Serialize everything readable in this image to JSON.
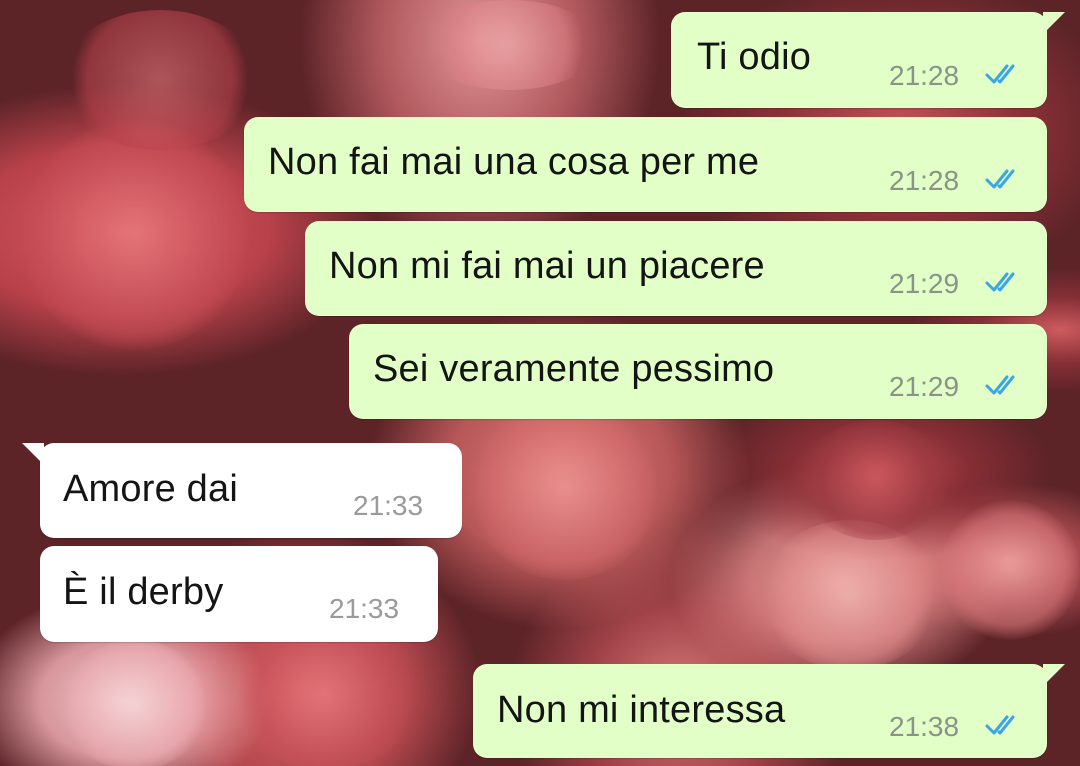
{
  "colors": {
    "outgoing_bubble": "#e2ffc8",
    "incoming_bubble": "#ffffff",
    "read_ticks": "#3aa6e8"
  },
  "messages": [
    {
      "direction": "outgoing",
      "text": "Ti odio",
      "time": "21:28",
      "status": "read",
      "status_icon": "double-check-icon"
    },
    {
      "direction": "outgoing",
      "text": "Non fai mai una cosa per me",
      "time": "21:28",
      "status": "read",
      "status_icon": "double-check-icon"
    },
    {
      "direction": "outgoing",
      "text": "Non mi fai mai un piacere",
      "time": "21:29",
      "status": "read",
      "status_icon": "double-check-icon"
    },
    {
      "direction": "outgoing",
      "text": "Sei veramente pessimo",
      "time": "21:29",
      "status": "read",
      "status_icon": "double-check-icon"
    },
    {
      "direction": "incoming",
      "text": "Amore dai",
      "time": "21:33"
    },
    {
      "direction": "incoming",
      "text": "È il derby",
      "time": "21:33"
    },
    {
      "direction": "outgoing",
      "text": "Non mi interessa",
      "time": "21:38",
      "status": "read",
      "status_icon": "double-check-icon"
    }
  ]
}
